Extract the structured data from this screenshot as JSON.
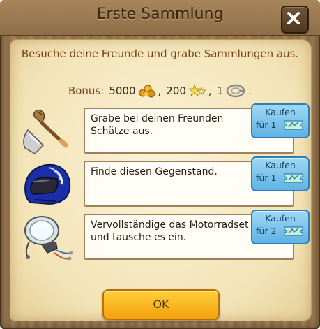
{
  "dialog": {
    "title": "Erste Sammlung",
    "subtitle": "Besuche deine Freunde und grabe Sammlungen aus."
  },
  "bonus": {
    "label": "Bonus:",
    "coins": "5000",
    "coins_icon": "gold-nuggets-icon",
    "stars": "200",
    "stars_icon": "star-gems-icon",
    "extra": "1",
    "extra_icon": "spiral-rope-icon"
  },
  "tasks": [
    {
      "text": "Grabe bei deinen Freunden Schätze aus.",
      "icon": "shovel-sack-icon",
      "buy_label": "Kaufen",
      "buy_prefix": "für",
      "buy_cost": "1",
      "buy_currency_icon": "ticket-icon"
    },
    {
      "text": "Finde diesen Gegenstand.",
      "icon": "motorcycle-helmet-icon",
      "buy_label": "Kaufen",
      "buy_prefix": "für",
      "buy_cost": "1",
      "buy_currency_icon": "ticket-icon"
    },
    {
      "text": "Vervollständige das Motorradset und tausche es ein.",
      "icon": "motorcycle-headlight-icon",
      "buy_label": "Kaufen",
      "buy_prefix": "für",
      "buy_cost": "2",
      "buy_currency_icon": "ticket-icon"
    }
  ],
  "ok_button": {
    "label": "OK"
  },
  "colors": {
    "title_text": "#3a2614",
    "subtitle_text": "#7a4212",
    "buy_button": "#5fb3e3",
    "ok_button": "#f3a20e",
    "parchment": "#f3e3b6"
  }
}
